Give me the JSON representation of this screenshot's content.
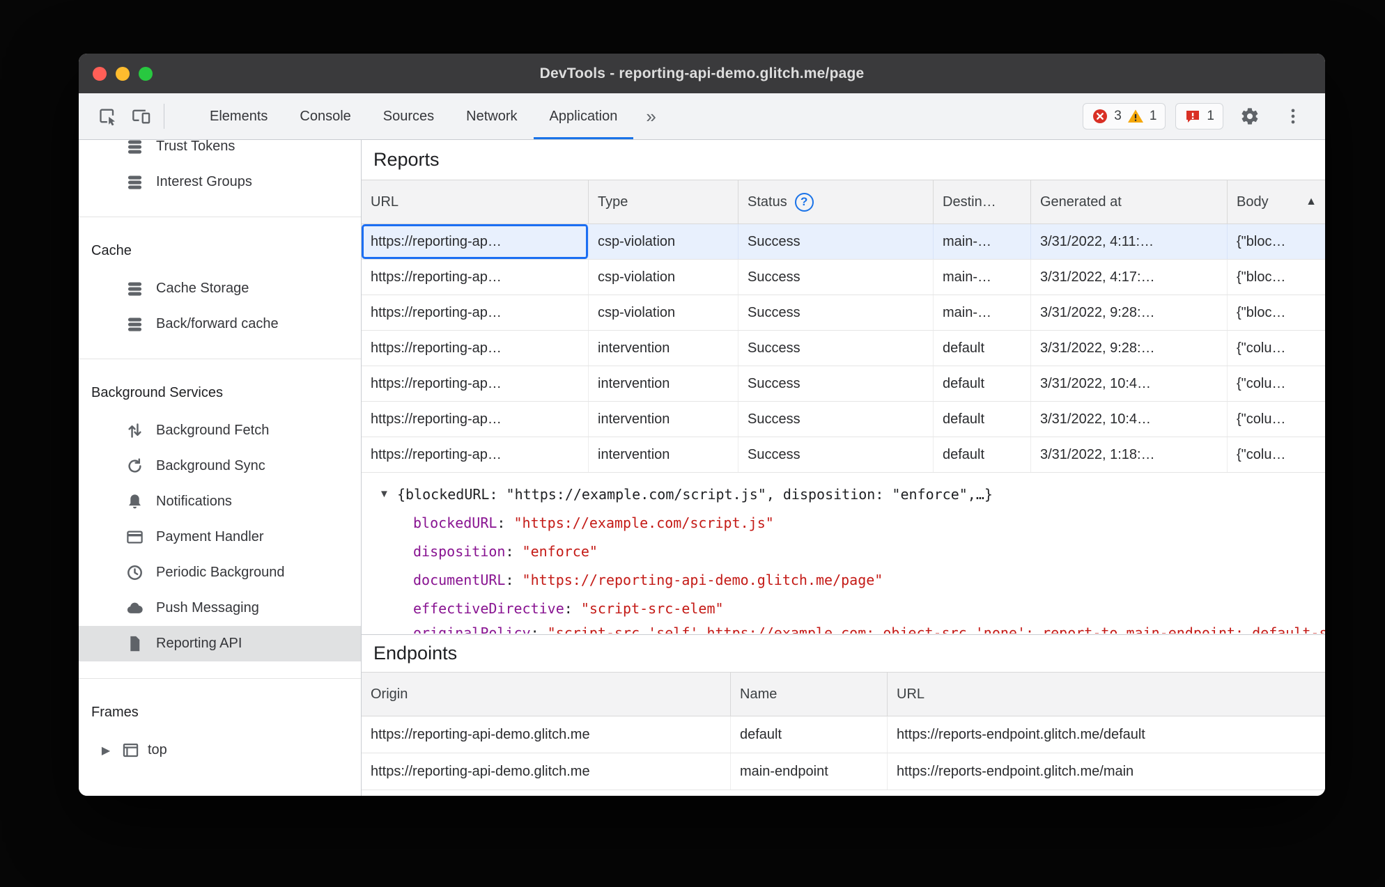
{
  "window": {
    "title": "DevTools - reporting-api-demo.glitch.me/page"
  },
  "toolbar": {
    "tabs": [
      "Elements",
      "Console",
      "Sources",
      "Network",
      "Application"
    ],
    "selected_tab": "Application",
    "error_count": "3",
    "warning_count": "1",
    "issue_count": "1"
  },
  "icons": {
    "more_tabs": "»",
    "status_help": "?",
    "sort_asc": "▲",
    "tree_expanded": "▼",
    "tree_collapsed": "▶"
  },
  "sidebar": {
    "trust_tokens": "Trust Tokens",
    "interest_groups": "Interest Groups",
    "cache_header": "Cache",
    "cache_storage": "Cache Storage",
    "back_forward_cache": "Back/forward cache",
    "background_services_header": "Background Services",
    "background_fetch": "Background Fetch",
    "background_sync": "Background Sync",
    "notifications": "Notifications",
    "payment_handler": "Payment Handler",
    "periodic_background": "Periodic Background",
    "push_messaging": "Push Messaging",
    "reporting_api": "Reporting API",
    "frames_header": "Frames",
    "frame_top": "top"
  },
  "reports": {
    "heading": "Reports",
    "columns": [
      "URL",
      "Type",
      "Status",
      "Destin…",
      "Generated at",
      "Body"
    ],
    "rows": [
      [
        "https://reporting-ap…",
        "csp-violation",
        "Success",
        "main-…",
        "3/31/2022, 4:11:…",
        "{\"bloc…"
      ],
      [
        "https://reporting-ap…",
        "csp-violation",
        "Success",
        "main-…",
        "3/31/2022, 4:17:…",
        "{\"bloc…"
      ],
      [
        "https://reporting-ap…",
        "csp-violation",
        "Success",
        "main-…",
        "3/31/2022, 9:28:…",
        "{\"bloc…"
      ],
      [
        "https://reporting-ap…",
        "intervention",
        "Success",
        "default",
        "3/31/2022, 9:28:…",
        "{\"colu…"
      ],
      [
        "https://reporting-ap…",
        "intervention",
        "Success",
        "default",
        "3/31/2022, 10:4…",
        "{\"colu…"
      ],
      [
        "https://reporting-ap…",
        "intervention",
        "Success",
        "default",
        "3/31/2022, 10:4…",
        "{\"colu…"
      ],
      [
        "https://reporting-ap…",
        "intervention",
        "Success",
        "default",
        "3/31/2022, 1:18:…",
        "{\"colu…"
      ]
    ]
  },
  "preview": {
    "summary": "{blockedURL: \"https://example.com/script.js\", disposition: \"enforce\",…}",
    "properties": [
      {
        "key": "blockedURL",
        "value": "\"https://example.com/script.js\""
      },
      {
        "key": "disposition",
        "value": "\"enforce\""
      },
      {
        "key": "documentURL",
        "value": "\"https://reporting-api-demo.glitch.me/page\""
      },
      {
        "key": "effectiveDirective",
        "value": "\"script-src-elem\""
      }
    ],
    "clipped_property": {
      "key": "originalPolicy",
      "value": "\"script-src 'self' https://example.com; object-src 'none'; report-to main-endpoint; default-src 'self'\""
    }
  },
  "endpoints": {
    "heading": "Endpoints",
    "columns": [
      "Origin",
      "Name",
      "URL"
    ],
    "rows": [
      [
        "https://reporting-api-demo.glitch.me",
        "default",
        "https://reports-endpoint.glitch.me/default"
      ],
      [
        "https://reporting-api-demo.glitch.me",
        "main-endpoint",
        "https://reports-endpoint.glitch.me/main"
      ]
    ]
  }
}
